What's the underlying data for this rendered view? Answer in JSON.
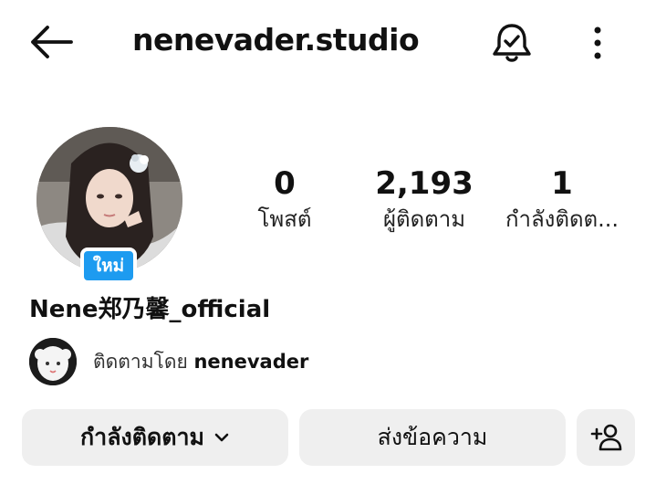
{
  "header": {
    "username": "nenevader.studio",
    "back_icon": "arrow-left-icon",
    "bell_icon": "bell-check-icon",
    "more_icon": "more-vertical-icon"
  },
  "profile": {
    "badge": "ใหม่",
    "display_name": "Nene郑乃馨_official",
    "stats": [
      {
        "value": "0",
        "label": "โพสต์"
      },
      {
        "value": "2,193",
        "label": "ผู้ติดตาม"
      },
      {
        "value": "1",
        "label": "กำลังติดต..."
      }
    ],
    "followed_by_prefix": "ติดตามโดย",
    "followed_by_user": "nenevader"
  },
  "actions": {
    "following_label": "กำลังติดตาม",
    "message_label": "ส่งข้อความ",
    "add_user_icon": "add-user-icon"
  },
  "colors": {
    "badge_bg": "#1d9bf0",
    "button_bg": "#efefef",
    "text": "#111111"
  }
}
